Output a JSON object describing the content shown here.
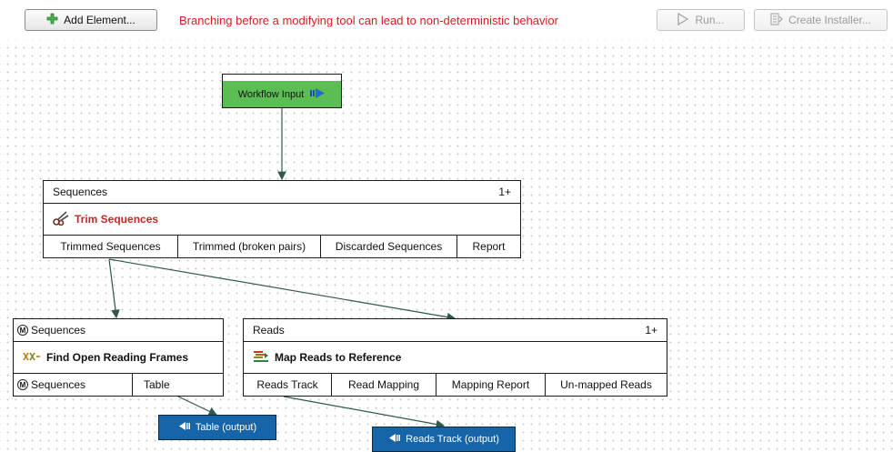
{
  "toolbar": {
    "add_element_label": "Add Element...",
    "warning_text": "Branching before a modifying tool can lead to non-deterministic behavior",
    "run_label": "Run...",
    "create_installer_label": "Create Installer..."
  },
  "workflow_input": {
    "label": "Workflow Input"
  },
  "trim_node": {
    "input_label": "Sequences",
    "multiplicity": "1+",
    "title": "Trim Sequences",
    "ports": [
      "Trimmed Sequences",
      "Trimmed (broken pairs)",
      "Discarded Sequences",
      "Report"
    ]
  },
  "orf_node": {
    "input_label": "Sequences",
    "input_marker": "M",
    "title": "Find Open Reading Frames",
    "ports": [
      "Sequences",
      "Table"
    ],
    "port_marker": "M"
  },
  "map_node": {
    "input_label": "Reads",
    "multiplicity": "1+",
    "title": "Map Reads to Reference",
    "ports": [
      "Reads Track",
      "Read Mapping",
      "Mapping Report",
      "Un-mapped Reads"
    ]
  },
  "outputs": {
    "table": "Table (output)",
    "reads_track": "Reads Track (output)"
  },
  "colors": {
    "warning": "#d21f1f",
    "input_node": "#5cbd55",
    "output_node": "#1565a8",
    "trim_title": "#c62828"
  }
}
